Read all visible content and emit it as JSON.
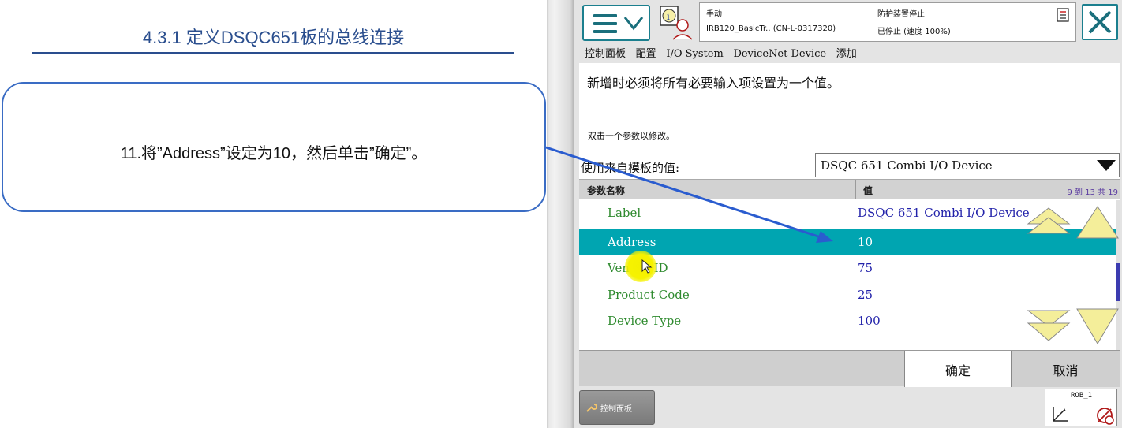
{
  "slide": {
    "title": "4.3.1  定义DSQC651板的总线连接",
    "instruction": "11.将”Address”设定为10，然后单击”确定”。"
  },
  "pendant": {
    "status": {
      "mode": "手动",
      "system": "IRB120_BasicTr.. (CN-L-0317320)",
      "guard": "防护装置停止",
      "state": "已停止 (速度 100%)"
    },
    "breadcrumb": "控制面板 - 配置 - I/O System - DeviceNet Device - 添加",
    "instruction": "新增时必须将所有必要输入项设置为一个值。",
    "hint": "双击一个参数以修改。",
    "template": {
      "label": "使用来自模板的值:",
      "value": "DSQC 651 Combi I/O Device"
    },
    "grid": {
      "col_name": "参数名称",
      "col_value": "值",
      "count": "9 到 13 共 19",
      "rows": [
        {
          "name": "Label",
          "value": "DSQC 651 Combi I/O Device",
          "selected": false
        },
        {
          "name": "Address",
          "value": "10",
          "selected": true
        },
        {
          "name": "Vendor ID",
          "value": "75",
          "selected": false
        },
        {
          "name": "Product Code",
          "value": "25",
          "selected": false
        },
        {
          "name": "Device Type",
          "value": "100",
          "selected": false
        }
      ]
    },
    "buttons": {
      "ok": "确定",
      "cancel": "取消"
    },
    "taskbar": {
      "control_panel": "控制面板"
    },
    "robot": "ROB_1"
  },
  "colors": {
    "accent": "#00a5b1",
    "frame": "#1b7f8e",
    "param_name": "#2e8a2e",
    "param_value": "#2222aa",
    "arrow": "#2a5ccf",
    "nav_arrow": "#f4ee9a"
  },
  "icons": [
    "hamburger-icon",
    "chevron-down-icon",
    "info-icon",
    "document-icon",
    "close-icon",
    "dropdown-arrow-icon",
    "scroll-up-all-icon",
    "scroll-up-icon",
    "scroll-down-all-icon",
    "scroll-down-icon",
    "wrench-icon",
    "axes-icon",
    "target-icon",
    "cursor-icon"
  ]
}
